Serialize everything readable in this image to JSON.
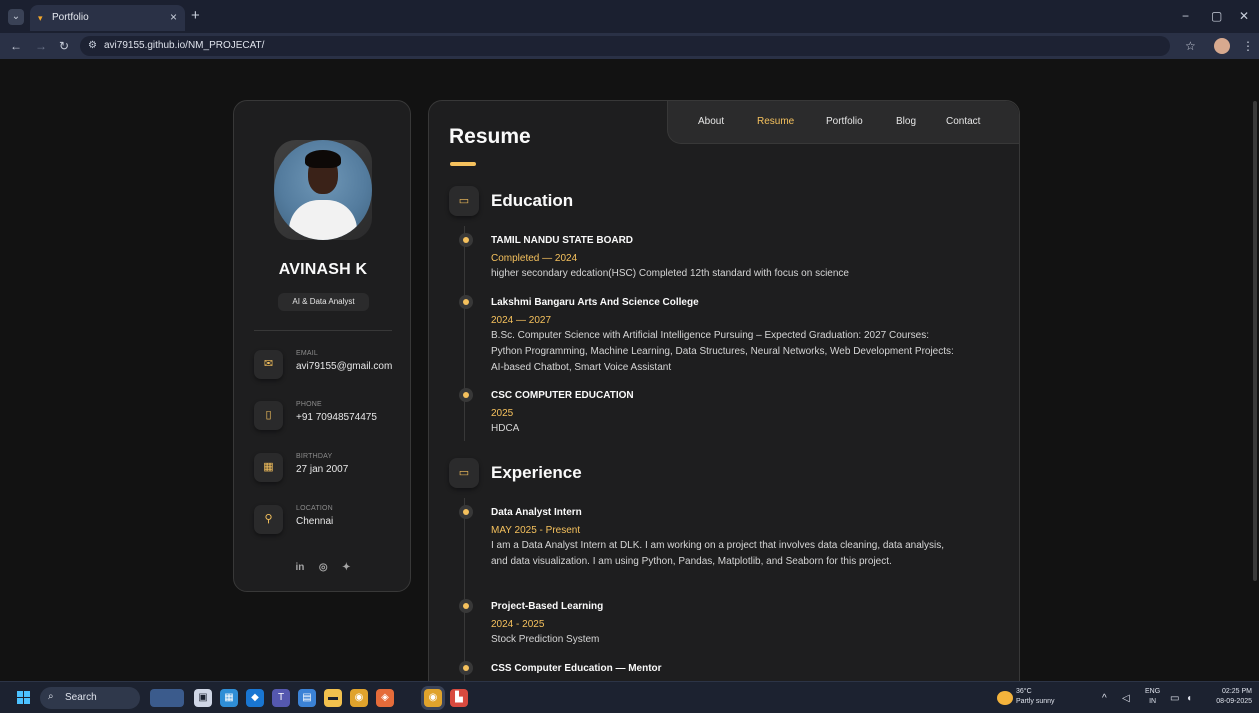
{
  "browser": {
    "tab_title": "Portfolio",
    "tab_close": "×",
    "new_tab": "+",
    "url": "avi79155.github.io/NM_PROJECAT/",
    "minimize": "−",
    "restore": "▢",
    "close": "✕"
  },
  "profile": {
    "name": "AVINASH K",
    "role": "AI & Data Analyst",
    "contacts": [
      {
        "label": "EMAIL",
        "value": "avi79155@gmail.com",
        "icon": "mail-icon"
      },
      {
        "label": "PHONE",
        "value": "+91 70948574475",
        "icon": "phone-icon"
      },
      {
        "label": "BIRTHDAY",
        "value": "27 jan 2007",
        "icon": "calendar-icon"
      },
      {
        "label": "LOCATION",
        "value": "Chennai",
        "icon": "location-icon"
      }
    ],
    "socials": [
      "linkedin-icon",
      "github-icon",
      "twitter-icon"
    ]
  },
  "nav": {
    "items": [
      "About",
      "Resume",
      "Portfolio",
      "Blog",
      "Contact"
    ],
    "active": "Resume"
  },
  "resume": {
    "title": "Resume",
    "education": {
      "heading": "Education",
      "items": [
        {
          "title": "TAMIL NANDU STATE BOARD",
          "date": "Completed — 2024",
          "text": "higher secondary edcation(HSC) Completed 12th standard with focus on science"
        },
        {
          "title": "Lakshmi Bangaru Arts And Science College",
          "date": "2024 — 2027",
          "text": "B.Sc. Computer Science with Artificial Intelligence Pursuing – Expected Graduation: 2027 Courses: Python Programming, Machine Learning, Data Structures, Neural Networks, Web Development Projects: AI-based Chatbot, Smart Voice Assistant"
        },
        {
          "title": "CSC COMPUTER EDUCATION",
          "date": "2025",
          "text": "HDCA"
        }
      ]
    },
    "experience": {
      "heading": "Experience",
      "items": [
        {
          "title": "Data Analyst Intern",
          "date": "MAY 2025 - Present",
          "text": "I am a Data Analyst Intern at DLK. I am working on a project that involves data cleaning, data analysis, and data visualization. I am using Python, Pandas, Matplotlib, and Seaborn for this project."
        },
        {
          "title": "Project-Based Learning",
          "date": "2024 - 2025",
          "text": "Stock Prediction System"
        },
        {
          "title": "CSS Computer Education — Mentor",
          "date": "",
          "text": ""
        }
      ]
    }
  },
  "taskbar": {
    "search": "Search",
    "weather_temp": "36°C",
    "weather_desc": "Partly sunny",
    "lang_top": "ENG",
    "lang_bottom": "IN",
    "time": "02:25 PM",
    "date": "08-09-2025"
  },
  "colors": {
    "accent": "#f5c15d",
    "panel": "#1e1e1f",
    "background": "#121212"
  }
}
